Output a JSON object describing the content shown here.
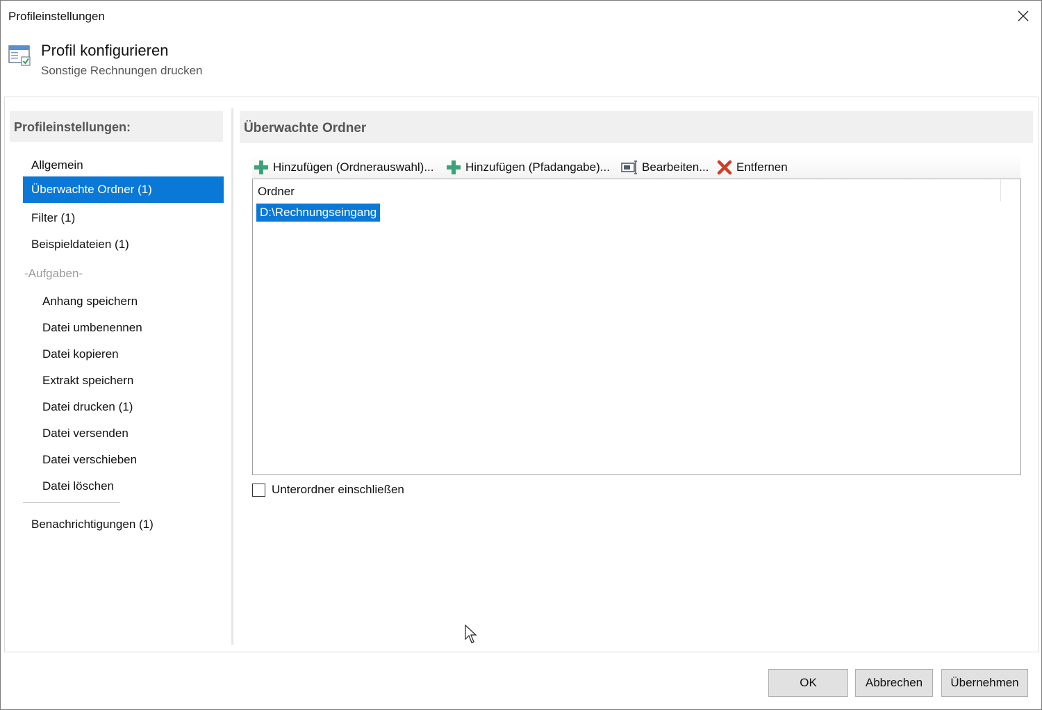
{
  "window": {
    "title": "Profileinstellungen"
  },
  "header": {
    "title": "Profil konfigurieren",
    "subtitle": "Sonstige Rechnungen drucken",
    "icon": "settings-window-icon"
  },
  "sidebar": {
    "heading": "Profileinstellungen:",
    "items": [
      {
        "label": "Allgemein"
      },
      {
        "label": "Überwachte Ordner (1)",
        "selected": true
      },
      {
        "label": "Filter (1)"
      },
      {
        "label": "Beispieldateien (1)"
      }
    ],
    "group_label": "-Aufgaben-",
    "tasks": [
      {
        "label": "Anhang speichern"
      },
      {
        "label": "Datei umbenennen"
      },
      {
        "label": "Datei kopieren"
      },
      {
        "label": "Extrakt speichern"
      },
      {
        "label": "Datei drucken (1)"
      },
      {
        "label": "Datei versenden"
      },
      {
        "label": "Datei verschieben"
      },
      {
        "label": "Datei löschen"
      }
    ],
    "notifications": {
      "label": "Benachrichtigungen (1)"
    }
  },
  "main": {
    "heading": "Überwachte Ordner",
    "toolbar": {
      "add_folder_select": "Hinzufügen (Ordnerauswahl)...",
      "add_path": "Hinzufügen (Pfadangabe)...",
      "edit": "Bearbeiten...",
      "remove": "Entfernen"
    },
    "list": {
      "column": "Ordner",
      "rows": [
        {
          "path": "D:\\Rechnungseingang",
          "selected": true
        }
      ]
    },
    "include_subfolders": {
      "label": "Unterordner einschließen",
      "checked": false
    }
  },
  "footer": {
    "ok": "OK",
    "cancel": "Abbrechen",
    "apply": "Übernehmen"
  },
  "colors": {
    "selection": "#0a78d7",
    "panel_header": "#f0f0f0",
    "add_icon": "#3aa37b",
    "remove_icon": "#d83b24"
  }
}
